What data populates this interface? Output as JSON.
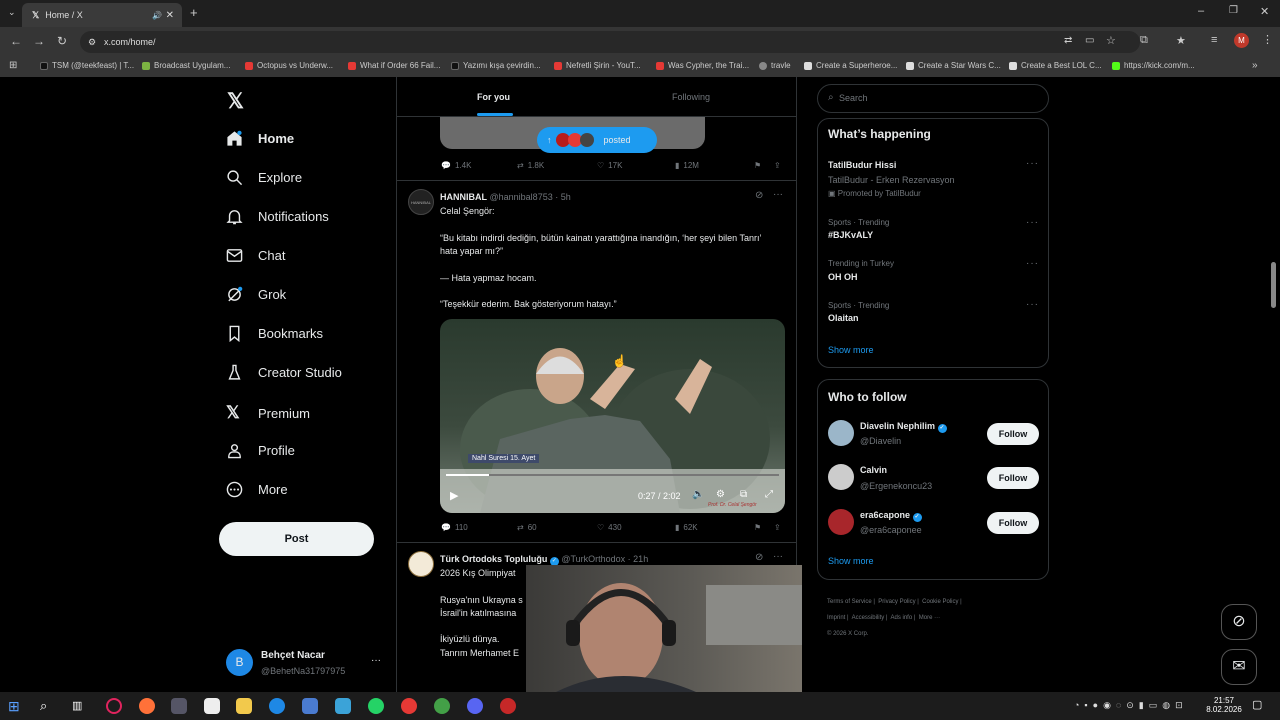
{
  "browser": {
    "tab_title": "Home / X",
    "url": "x.com/home/",
    "bookmarks": [
      "TSM (@teekfeast) | T...",
      "Broadcast Uygulam...",
      "Octopus vs Underw...",
      "What if Order 66 Fail...",
      "Yazımı kışa çevirdin...",
      "Nefretli Şirin - YouT...",
      "Was Cypher, the Trai...",
      "travle",
      "Create a Superheroe...",
      "Create a Star Wars C...",
      "Create a Best LOL C...",
      "https://kick.com/m..."
    ]
  },
  "nav": {
    "items": [
      "Home",
      "Explore",
      "Notifications",
      "Chat",
      "Grok",
      "Bookmarks",
      "Creator Studio",
      "Premium",
      "Profile",
      "More"
    ],
    "post_label": "Post",
    "user_name": "Behçet Nacar",
    "user_handle": "@BehetNa31797975",
    "avatar_letter": "B"
  },
  "feed": {
    "tabs": [
      "For you",
      "Following"
    ],
    "posted_pill": "posted",
    "top_stats": [
      "1.4K",
      "1.8K",
      "17K",
      "12M"
    ],
    "tweet1": {
      "name": "HANNIBAL",
      "handle": "@hannibal8753 · 5h",
      "lines": [
        "Celal Şengör:",
        "“Bu kitabı indirdi dediğin, bütün kainatı yarattığına inandığın, ‘her şeyi bilen Tanrı’ hata yapar mı?”",
        "— Hata yapmaz hocam.",
        "“Teşekkür ederim. Bak gösteriyorum hatayı.”"
      ],
      "video_caption": "Nahl Suresi 15. Ayet",
      "video_time": "0:27 / 2:02",
      "watermark": "Prof. Dr. Celal Şengör",
      "stats": [
        "110",
        "60",
        "430",
        "62K"
      ]
    },
    "tweet2": {
      "name": "Türk Ortodoks Topluluğu",
      "handle": "@TurkOrthodox · 21h",
      "lines": [
        "2026 Kış Olimpiyat",
        "Rusya'nın Ukrayna s",
        "İsrail'in katılmasına",
        "İkiyüzlü dünya.",
        "Tanrım Merhamet E"
      ]
    }
  },
  "right": {
    "search_placeholder": "Search",
    "happening_title": "What’s happening",
    "trends": [
      {
        "meta": "TatilBudur Hissi",
        "sub": "TatilBudur - Erken Rezervasyon",
        "promo": "Promoted by TatilBudur"
      },
      {
        "meta": "Sports · Trending",
        "title": "#BJKvALY"
      },
      {
        "meta": "Trending in Turkey",
        "title": "OH OH"
      },
      {
        "meta": "Sports · Trending",
        "title": "Olaitan"
      }
    ],
    "show_more": "Show more",
    "who_title": "Who to follow",
    "follow": [
      {
        "name": "Diavelin Nephilim",
        "handle": "@Diavelin"
      },
      {
        "name": "Calvin",
        "handle": "@Ergenekoncu23"
      },
      {
        "name": "era6capone",
        "handle": "@era6caponee"
      }
    ],
    "follow_label": "Follow",
    "footer": [
      "Terms of Service",
      "Privacy Policy",
      "Cookie Policy",
      "Imprint",
      "Accessibility",
      "Ads info",
      "More ···",
      "© 2026 X Corp."
    ]
  },
  "taskbar": {
    "time": "21:57",
    "date": "8.02.2026"
  },
  "colors": {
    "accent": "#1d9bf0",
    "bg": "#000000"
  }
}
